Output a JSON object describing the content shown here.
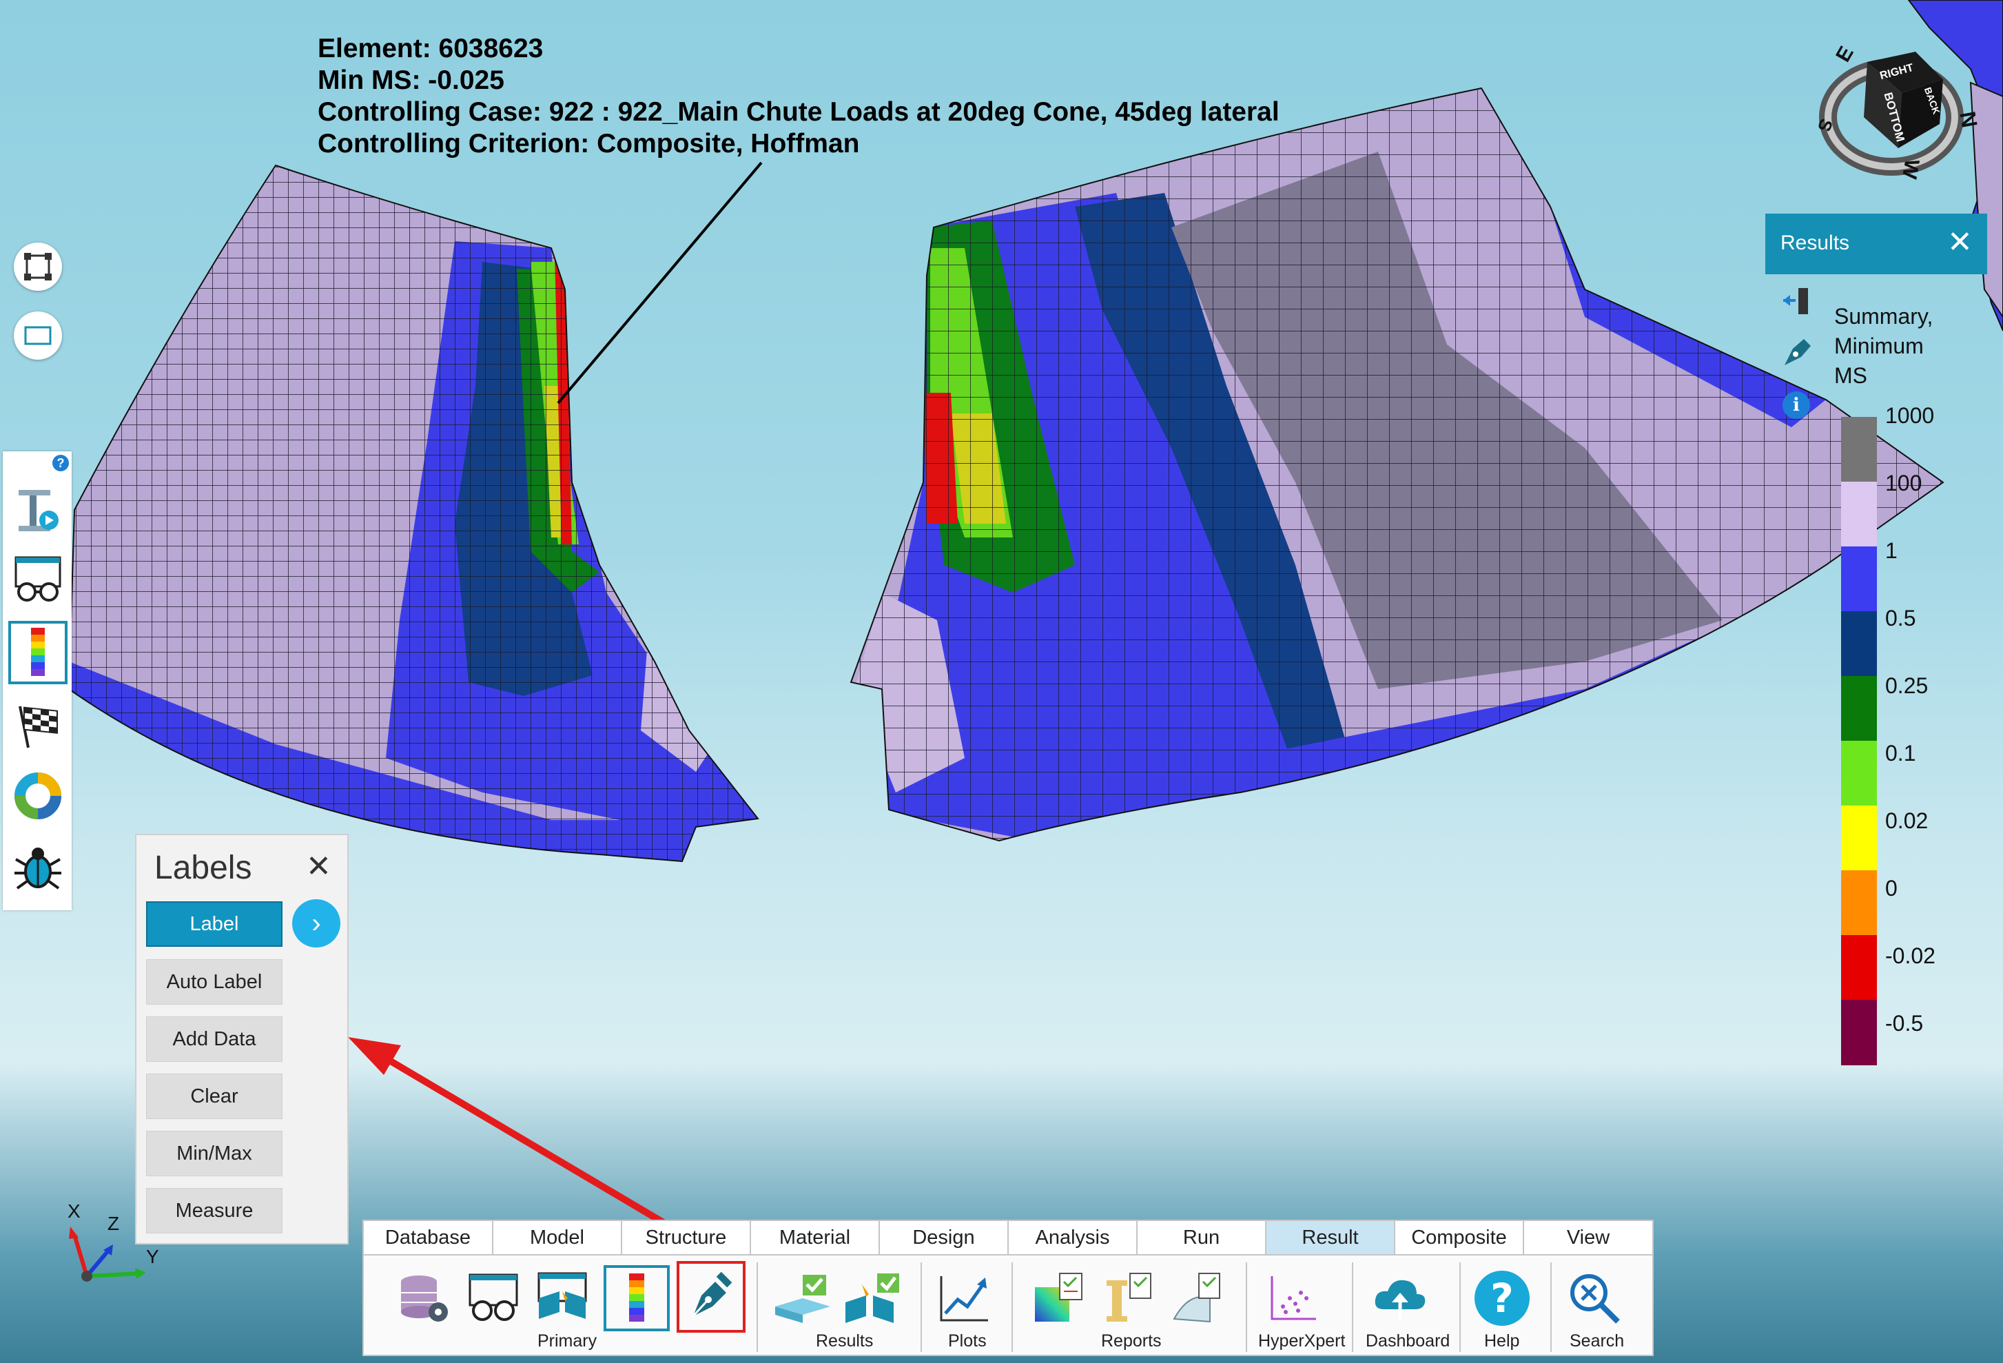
{
  "annotation": {
    "element": "Element: 6038623",
    "min_ms": "Min MS: -0.025",
    "case": "Controlling Case: 922 : 922_Main Chute Loads at 20deg Cone, 45deg lateral",
    "criterion": "Controlling Criterion: Composite, Hoffman"
  },
  "viewcube": {
    "faces": [
      "RIGHT",
      "BACK",
      "BOTTOM"
    ],
    "compass": [
      "E",
      "N",
      "W",
      "S"
    ]
  },
  "results_panel": {
    "title": "Results",
    "close": "✕",
    "line1": "Summary,",
    "line2": "Minimum",
    "line3": "MS"
  },
  "legend": {
    "labels": [
      "1000",
      "100",
      "1",
      "0.5",
      "0.25",
      "0.1",
      "0.02",
      "0",
      "-0.02",
      "-0.5"
    ],
    "colors": [
      "#757575",
      "#dcc8f0",
      "#3c3cf0",
      "#0a3a7e",
      "#0a7a0a",
      "#6ee61e",
      "#ffff00",
      "#ff8c00",
      "#e60000",
      "#7a0040"
    ]
  },
  "labels_panel": {
    "title": "Labels",
    "close": "✕",
    "buttons": [
      "Label",
      "Auto Label",
      "Add Data",
      "Clear",
      "Min/Max",
      "Measure"
    ],
    "next": "›"
  },
  "ribbon": {
    "tabs": [
      "Database",
      "Model",
      "Structure",
      "Material",
      "Design",
      "Analysis",
      "Run",
      "Result",
      "Composite",
      "View"
    ],
    "active_tab": "Result",
    "groups": [
      "Primary",
      "Results",
      "Plots",
      "Reports",
      "HyperXpert",
      "Dashboard",
      "Help",
      "Search"
    ]
  },
  "axes": {
    "x": "X",
    "y": "Y",
    "z": "Z"
  },
  "colors": {
    "accent": "#158fb3",
    "highlight_border": "#e02020"
  }
}
